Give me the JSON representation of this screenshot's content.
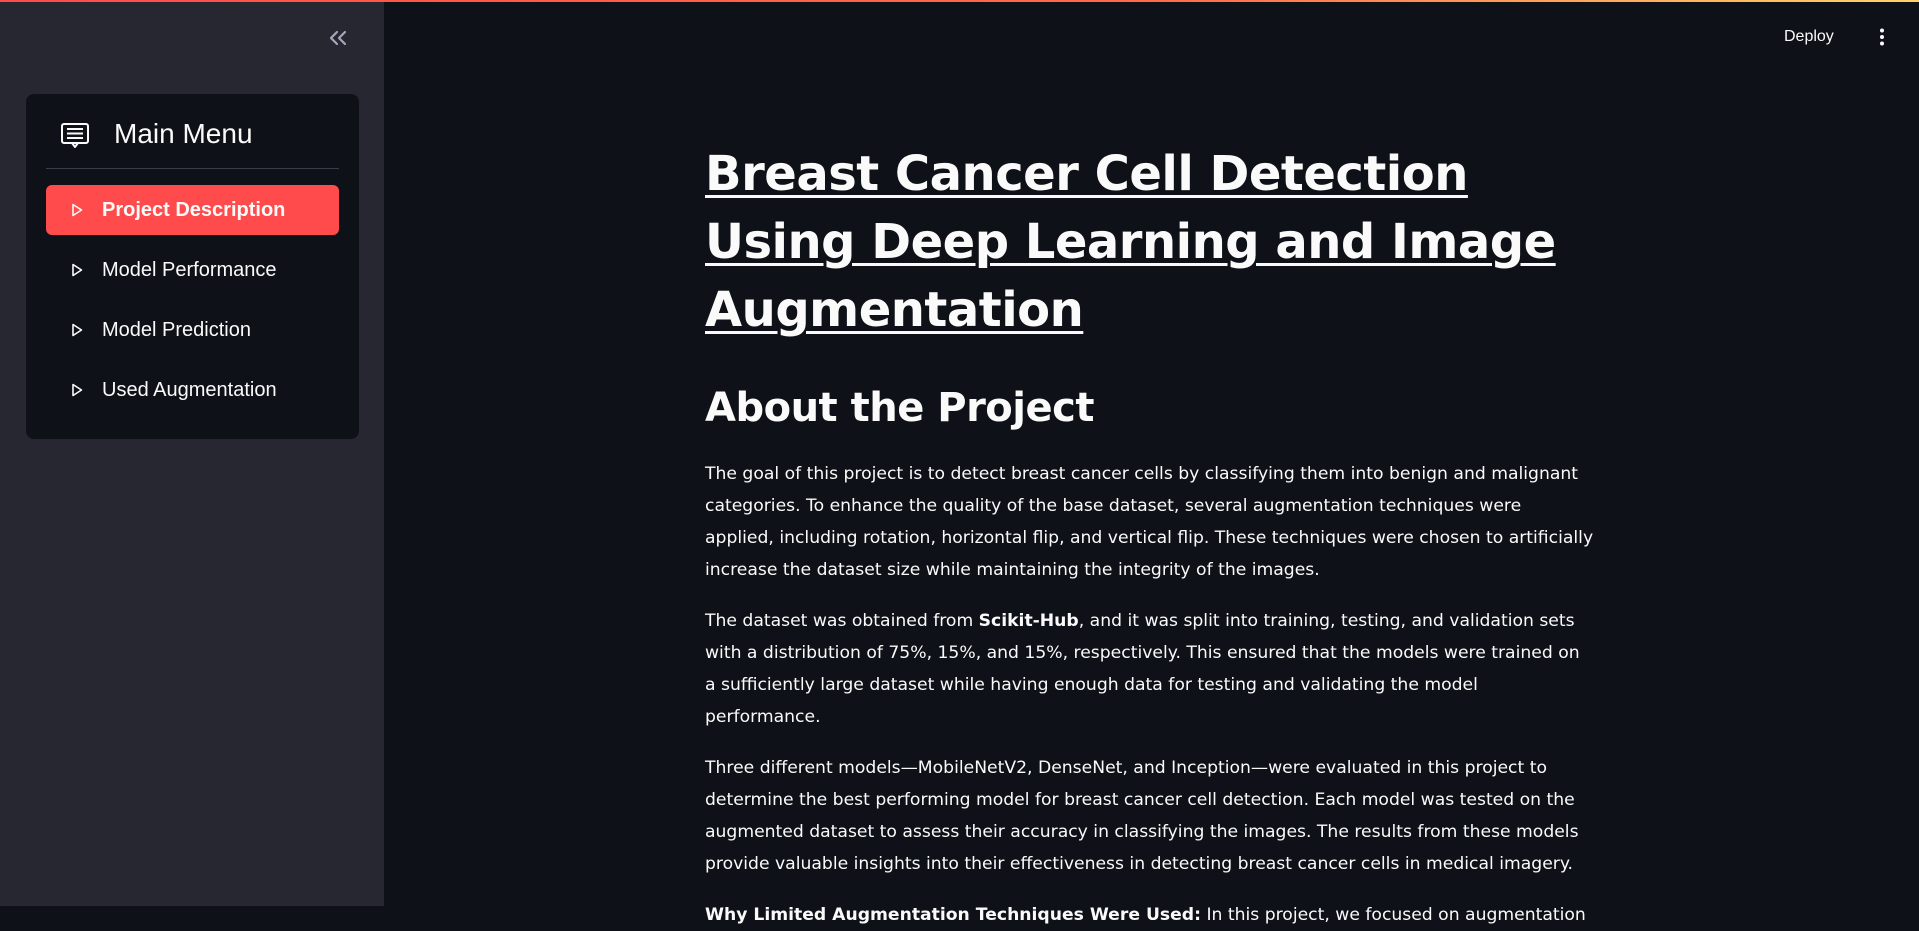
{
  "header": {
    "deploy_label": "Deploy",
    "menu_icon": "kebab-menu-icon",
    "accent_gradient": [
      "#ff4b4b",
      "#ffd36a"
    ]
  },
  "sidebar": {
    "collapse_icon": "double-chevron-left-icon",
    "menu_title": "Main Menu",
    "menu_icon": "menu-card-icon",
    "items": [
      {
        "label": "Project Description",
        "active": true,
        "icon": "caret-right-icon"
      },
      {
        "label": "Model Performance",
        "active": false,
        "icon": "caret-right-icon"
      },
      {
        "label": "Model Prediction",
        "active": false,
        "icon": "caret-right-icon"
      },
      {
        "label": "Used Augmentation",
        "active": false,
        "icon": "caret-right-icon"
      }
    ],
    "active_color": "#ff4b4b",
    "background": "#262730"
  },
  "main": {
    "title": "Breast Cancer Cell Detection Using Deep Learning and Image Augmentation",
    "section_title": "About the Project",
    "paragraphs": {
      "p1": "The goal of this project is to detect breast cancer cells by classifying them into benign and malignant categories. To enhance the quality of the base dataset, several augmentation techniques were applied, including rotation, horizontal flip, and vertical flip. These techniques were chosen to artificially increase the dataset size while maintaining the integrity of the images.",
      "p2_before": "The dataset was obtained from ",
      "p2_bold": "Scikit-Hub",
      "p2_after": ", and it was split into training, testing, and validation sets with a distribution of 75%, 15%, and 15%, respectively. This ensured that the models were trained on a sufficiently large dataset while having enough data for testing and validating the model performance.",
      "p3": "Three different models—MobileNetV2, DenseNet, and Inception—were evaluated in this project to determine the best performing model for breast cancer cell detection. Each model was tested on the augmented dataset to assess their accuracy in classifying the images. The results from these models provide valuable insights into their effectiveness in detecting breast cancer cells in medical imagery.",
      "p4_bold": "Why Limited Augmentation Techniques Were Used:",
      "p4_after": " In this project, we focused on augmentation"
    }
  }
}
